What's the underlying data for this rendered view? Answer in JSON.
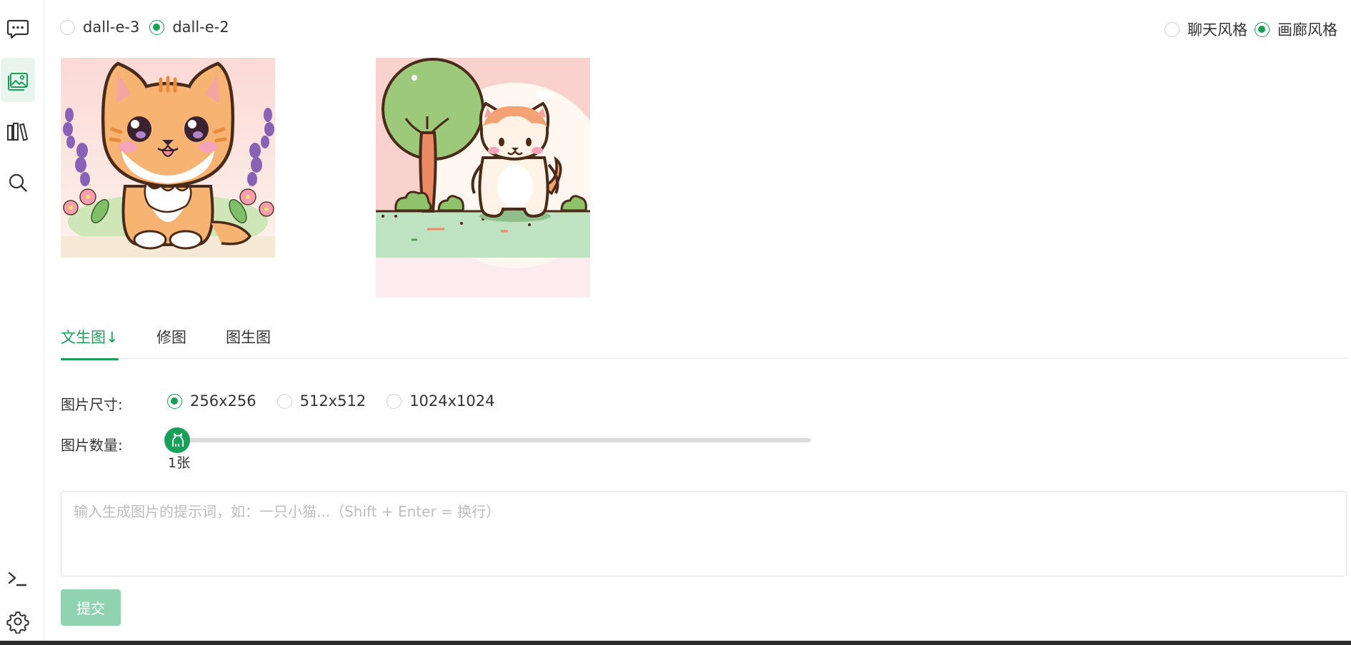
{
  "model_options": [
    {
      "label": "dall-e-3",
      "selected": false
    },
    {
      "label": "dall-e-2",
      "selected": true
    }
  ],
  "view_styles": [
    {
      "label": "聊天风格",
      "selected": false
    },
    {
      "label": "画廊风格",
      "selected": true
    }
  ],
  "tabs": [
    {
      "label": "文生图↓",
      "active": true
    },
    {
      "label": "修图",
      "active": false
    },
    {
      "label": "图生图",
      "active": false
    }
  ],
  "form": {
    "size_label": "图片尺寸:",
    "sizes": [
      {
        "label": "256x256",
        "selected": true
      },
      {
        "label": "512x512",
        "selected": false
      },
      {
        "label": "1024x1024",
        "selected": false
      }
    ],
    "count_label": "图片数量:",
    "count_value": "1张",
    "count_fraction": 0.0,
    "prompt_placeholder": "输入生成图片的提示词，如：一只小猫...（Shift + Enter = 换行）",
    "submit_label": "提交"
  },
  "colors": {
    "accent": "#18a058",
    "submit_disabled": "#8fd3b0"
  },
  "rail_icons": [
    "chat-icon",
    "image-gallery-icon",
    "library-icon",
    "search-icon",
    "terminal-icon",
    "gear-icon"
  ]
}
